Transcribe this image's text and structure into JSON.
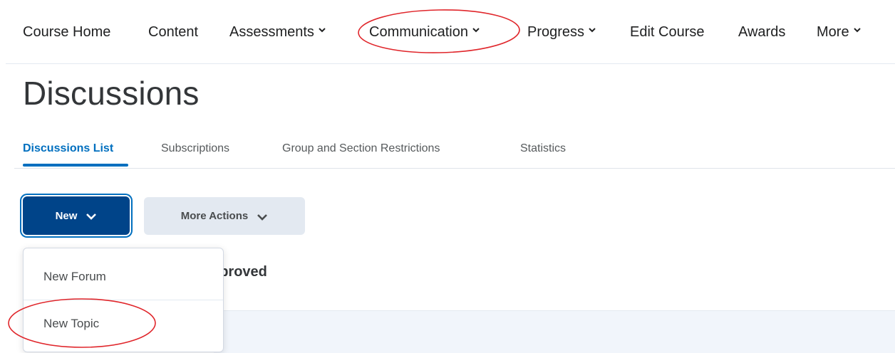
{
  "nav": {
    "items": [
      {
        "label": "Course Home",
        "has_menu": false
      },
      {
        "label": "Content",
        "has_menu": false
      },
      {
        "label": "Assessments",
        "has_menu": true
      },
      {
        "label": "Communication",
        "has_menu": true
      },
      {
        "label": "Progress",
        "has_menu": true
      },
      {
        "label": "Edit Course",
        "has_menu": false
      },
      {
        "label": "Awards",
        "has_menu": false
      },
      {
        "label": "More",
        "has_menu": true
      }
    ]
  },
  "page": {
    "title": "Discussions"
  },
  "tabs": [
    {
      "label": "Discussions List",
      "active": true
    },
    {
      "label": "Subscriptions",
      "active": false
    },
    {
      "label": "Group and Section Restrictions",
      "active": false
    },
    {
      "label": "Statistics",
      "active": false
    }
  ],
  "toolbar": {
    "new_label": "New",
    "more_actions_label": "More Actions"
  },
  "dropdown": {
    "items": [
      {
        "label": "New Forum"
      },
      {
        "label": "New Topic"
      }
    ]
  },
  "background": {
    "heading_fragment": "pproved"
  },
  "annotations": {
    "color": "#e0262b",
    "circled": [
      "Communication",
      "New Topic"
    ]
  },
  "colors": {
    "accent": "#006fbf",
    "primary_button": "#004489",
    "secondary_button": "#e3e9f1"
  },
  "icons": {
    "menu_chevron": "chevron-down-icon"
  }
}
